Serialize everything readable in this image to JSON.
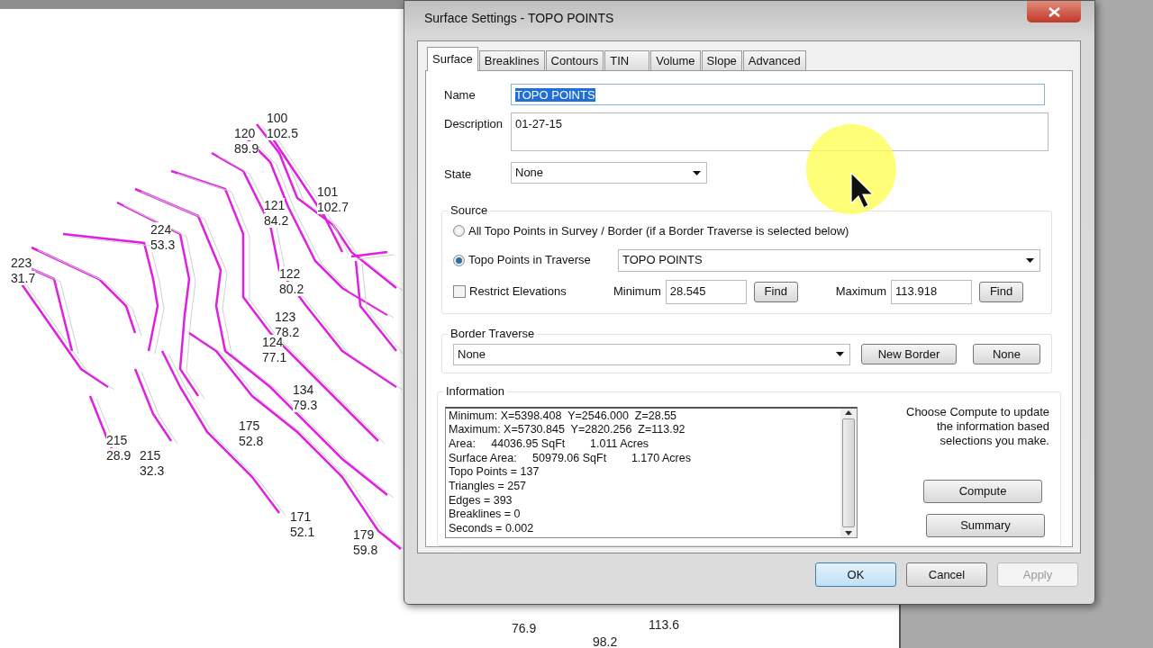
{
  "cad_view": {
    "points": [
      {
        "number": "100",
        "elevation": "102.5"
      },
      {
        "number": "120",
        "elevation": "89.9"
      },
      {
        "number": "101",
        "elevation": "102.7"
      },
      {
        "number": "121",
        "elevation": "84.2"
      },
      {
        "number": "224",
        "elevation": "53.3"
      },
      {
        "number": "122",
        "elevation": "80.2"
      },
      {
        "number": "123",
        "elevation": "78.2"
      },
      {
        "number": "124",
        "elevation": "77.1"
      },
      {
        "number": "223",
        "elevation": "31.7"
      },
      {
        "number": "215",
        "elevation": "28.9"
      },
      {
        "number": "215",
        "elevation": "32.3"
      },
      {
        "number": "175",
        "elevation": "52.8"
      },
      {
        "number": "171",
        "elevation": "52.1"
      },
      {
        "number": "179",
        "elevation": "59.8"
      },
      {
        "number": "134",
        "elevation": "79.3"
      },
      {
        "number": "76.9"
      },
      {
        "number": "113.6"
      },
      {
        "number": "98.2"
      }
    ]
  },
  "dialog": {
    "title": "Surface Settings - TOPO POINTS",
    "tabs": [
      {
        "label": "Surface",
        "selected": true
      },
      {
        "label": "Breaklines",
        "selected": false
      },
      {
        "label": "Contours",
        "selected": false
      },
      {
        "label": "TIN",
        "selected": false
      },
      {
        "label": "Volume",
        "selected": false
      },
      {
        "label": "Slope",
        "selected": false
      },
      {
        "label": "Advanced",
        "selected": false
      }
    ],
    "name": {
      "label": "Name",
      "value": "TOPO POINTS",
      "highlighted": true
    },
    "description": {
      "label": "Description",
      "value": "01-27-15"
    },
    "state": {
      "label": "State",
      "value": "None"
    },
    "source": {
      "title": "Source",
      "options": [
        {
          "label": "All Topo Points in Survey / Border (if a Border Traverse is selected below)",
          "selected": false
        },
        {
          "label": "Topo Points in Traverse",
          "selected": true
        }
      ],
      "traverse": "TOPO POINTS",
      "restrict": {
        "label": "Restrict Elevations",
        "checked": false
      },
      "minimum": {
        "label": "Minimum",
        "value": "28.545",
        "button": "Find"
      },
      "maximum": {
        "label": "Maximum",
        "value": "113.918",
        "button": "Find"
      }
    },
    "border_traverse": {
      "title": "Border Traverse",
      "value": "None",
      "buttons": [
        "New Border",
        "None"
      ]
    },
    "information": {
      "title": "Information",
      "lines": [
        "Minimum: X=5398.408  Y=2546.000  Z=28.55",
        "Maximum: X=5730.845  Y=2820.256  Z=113.92",
        "Area:     44036.95 SqFt        1.011 Acres",
        "Surface Area:     50979.06 SqFt        1.170 Acres",
        "Topo Points = 137",
        "Triangles = 257",
        "Edges = 393",
        "Breaklines = 0",
        "Seconds = 0.002"
      ],
      "hint": "Choose Compute to update the information based selections you make.",
      "buttons": [
        "Compute",
        "Summary"
      ]
    },
    "footer_buttons": [
      {
        "label": "OK",
        "default": true,
        "disabled": false
      },
      {
        "label": "Cancel",
        "default": false,
        "disabled": false
      },
      {
        "label": "Apply",
        "default": false,
        "disabled": true
      }
    ]
  }
}
